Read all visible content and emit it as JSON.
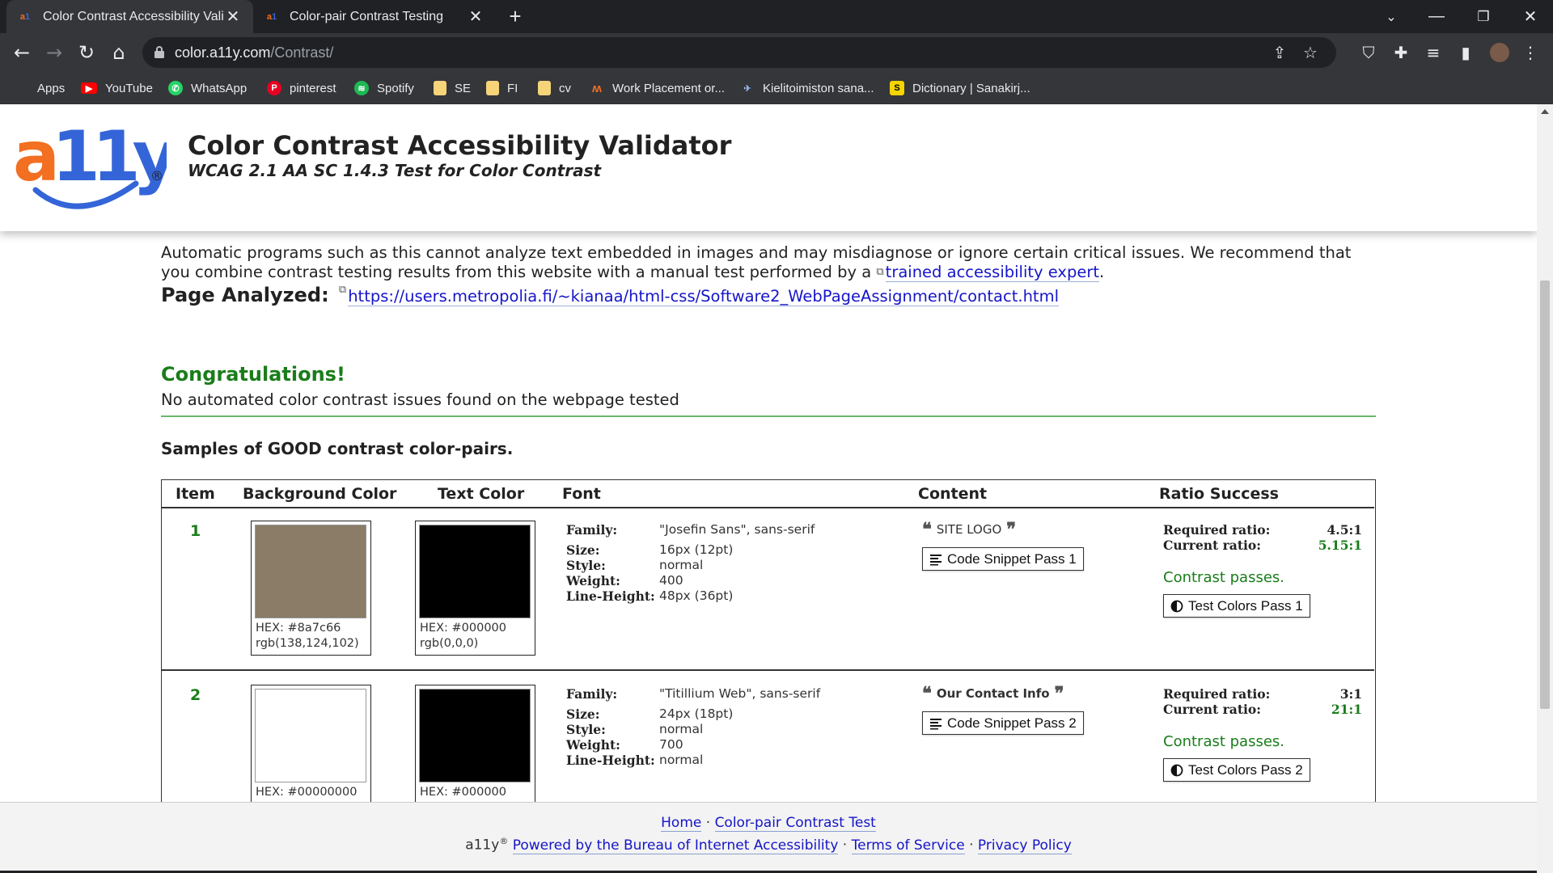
{
  "browser": {
    "tabs": [
      {
        "title": "Color Contrast Accessibility Valid",
        "active": true
      },
      {
        "title": "Color-pair Contrast Testing",
        "active": false
      }
    ],
    "url_host": "color.a11y.com",
    "url_path": "/Contrast/",
    "bookmarks": [
      {
        "label": "Apps",
        "icon": "apps-grid-icon"
      },
      {
        "label": "YouTube",
        "icon": "youtube-icon"
      },
      {
        "label": "WhatsApp",
        "icon": "whatsapp-icon"
      },
      {
        "label": "pinterest",
        "icon": "pinterest-icon"
      },
      {
        "label": "Spotify",
        "icon": "spotify-icon"
      },
      {
        "label": "SE",
        "icon": "folder-icon"
      },
      {
        "label": "FI",
        "icon": "folder-icon"
      },
      {
        "label": "cv",
        "icon": "folder-icon"
      },
      {
        "label": "Work Placement or...",
        "icon": "site-icon"
      },
      {
        "label": "Kielitoimiston sana...",
        "icon": "site-icon"
      },
      {
        "label": "Dictionary | Sanakirj...",
        "icon": "sanakirja-icon"
      }
    ]
  },
  "site": {
    "title": "Color Contrast Accessibility Validator",
    "subtitle": "WCAG 2.1 AA SC 1.4.3 Test for Color Contrast"
  },
  "intro": {
    "text": "Automatic programs such as this cannot analyze text embedded in images and may misdiagnose or ignore certain critical issues. We recommend that you combine contrast testing results from this website with a manual test performed by a ",
    "link": "trained accessibility expert",
    "end": "."
  },
  "analyzed": {
    "label": "Page Analyzed:",
    "url": "https://users.metropolia.fi/~kianaa/html-css/Software2_WebPageAssignment/contact.html"
  },
  "result": {
    "heading": "Congratulations!",
    "message": "No automated color contrast issues found on the webpage tested"
  },
  "samples_heading": "Samples of GOOD contrast color-pairs.",
  "table": {
    "headers": [
      "Item",
      "Background Color",
      "Text Color",
      "Font",
      "Content",
      "Ratio Success"
    ],
    "font_keys": [
      "Family:",
      "Size:",
      "Style:",
      "Weight:",
      "Line-Height:"
    ],
    "required_label": "Required ratio:",
    "current_label": "Current ratio:",
    "rows": [
      {
        "item": "1",
        "bg": {
          "hex": "HEX: #8a7c66",
          "rgb": "rgb(138,124,102)",
          "color": "#8a7c66"
        },
        "fg": {
          "hex": "HEX: #000000",
          "rgb": "rgb(0,0,0)",
          "color": "#000000"
        },
        "font": {
          "family": "\"Josefin Sans\", sans-serif",
          "size": "16px (12pt)",
          "style": "normal",
          "weight": "400",
          "line_height": "48px (36pt)"
        },
        "content": "SITE LOGO",
        "snippet_button": "Code Snippet Pass 1",
        "required": "4.5:1",
        "current": "5.15:1",
        "status": "Contrast passes.",
        "test_button": "Test Colors Pass 1"
      },
      {
        "item": "2",
        "bg": {
          "hex": "HEX: #00000000",
          "rgb": "",
          "color": "#ffffff"
        },
        "fg": {
          "hex": "HEX: #000000",
          "rgb": "",
          "color": "#000000"
        },
        "font": {
          "family": "\"Titillium Web\", sans-serif",
          "size": "24px (18pt)",
          "style": "normal",
          "weight": "700",
          "line_height": "normal"
        },
        "content": "Our Contact Info",
        "snippet_button": "Code Snippet Pass 2",
        "required": "3:1",
        "current": "21:1",
        "status": "Contrast passes.",
        "test_button": "Test Colors Pass 2"
      }
    ]
  },
  "footer": {
    "home": "Home",
    "sep": "·",
    "pair_test": "Color-pair Contrast Test",
    "brand": "a11y",
    "reg": "®",
    "powered": "Powered by the Bureau of Internet Accessibility",
    "tos": "Terms of Service",
    "privacy": "Privacy Policy"
  }
}
